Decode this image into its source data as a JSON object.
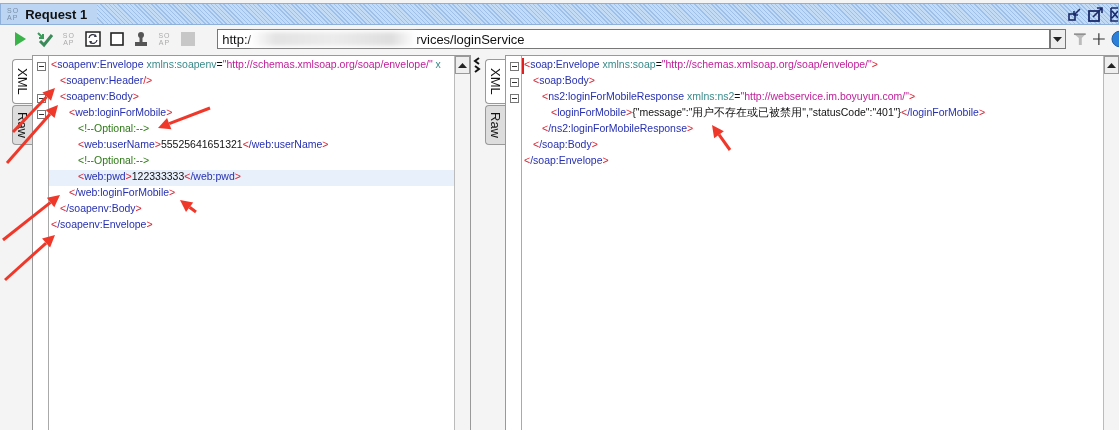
{
  "title_bar": {
    "logo": [
      "SO",
      "AP"
    ],
    "title": "Request 1"
  },
  "toolbar": {
    "buttons": [
      {
        "kind": "run",
        "disabled": false
      },
      {
        "kind": "check",
        "disabled": false
      },
      {
        "kind": "soap",
        "glyph": [
          "SO",
          "AP"
        ],
        "disabled": true
      },
      {
        "kind": "refresh",
        "disabled": false
      },
      {
        "kind": "square",
        "disabled": false
      },
      {
        "kind": "stamp",
        "disabled": false
      },
      {
        "kind": "soap",
        "glyph": [
          "SO",
          "AP"
        ],
        "disabled": true
      },
      {
        "kind": "stop",
        "disabled": true
      }
    ],
    "url_start": "http:/",
    "url_end": "rvices/loginService"
  },
  "request": {
    "tabs": [
      {
        "label": "XML",
        "selected": true
      },
      {
        "label": "Raw",
        "selected": false
      }
    ],
    "lines": [
      {
        "tokens": [
          {
            "kind": "punct",
            "text": "<"
          },
          {
            "kind": "tag",
            "text": "soapenv:Envelope "
          },
          {
            "kind": "attr",
            "text": "xmlns:soapenv"
          },
          {
            "kind": "eq",
            "text": "="
          },
          {
            "kind": "value",
            "text": "\"http://schemas.xmlsoap.org/soap/envelope/\""
          },
          {
            "kind": "attr",
            "text": " x"
          }
        ],
        "foldable": true,
        "selected": false,
        "children": [
          {
            "tokens": [
              {
                "kind": "punct",
                "text": "<"
              },
              {
                "kind": "tag",
                "text": "soapenv:Header"
              },
              {
                "kind": "punct",
                "text": "/>"
              }
            ],
            "foldable": false,
            "selected": false
          },
          {
            "tokens": [
              {
                "kind": "punct",
                "text": "<"
              },
              {
                "kind": "tag",
                "text": "soapenv:Body"
              },
              {
                "kind": "punct",
                "text": ">"
              }
            ],
            "foldable": true,
            "selected": false,
            "children": [
              {
                "tokens": [
                  {
                    "kind": "punct",
                    "text": "<"
                  },
                  {
                    "kind": "tag",
                    "text": "web:loginForMobile"
                  },
                  {
                    "kind": "punct",
                    "text": ">"
                  }
                ],
                "foldable": true,
                "selected": false,
                "children": [
                  {
                    "tokens": [
                      {
                        "kind": "comment",
                        "text": "<!--Optional:-->"
                      }
                    ],
                    "foldable": false,
                    "selected": false
                  },
                  {
                    "tokens": [
                      {
                        "kind": "punct",
                        "text": "<"
                      },
                      {
                        "kind": "tag",
                        "text": "web:userName"
                      },
                      {
                        "kind": "punct",
                        "text": ">"
                      },
                      {
                        "kind": "text",
                        "text": "55525641651321"
                      },
                      {
                        "kind": "punct",
                        "text": "<"
                      },
                      {
                        "kind": "tag",
                        "text": "/web:userName"
                      },
                      {
                        "kind": "punct",
                        "text": ">"
                      }
                    ],
                    "foldable": false,
                    "selected": false
                  },
                  {
                    "tokens": [
                      {
                        "kind": "comment",
                        "text": "<!--Optional:-->"
                      }
                    ],
                    "foldable": false,
                    "selected": false
                  },
                  {
                    "tokens": [
                      {
                        "kind": "punct",
                        "text": "<"
                      },
                      {
                        "kind": "tag",
                        "text": "web:pwd"
                      },
                      {
                        "kind": "punct",
                        "text": ">"
                      },
                      {
                        "kind": "text",
                        "text": "122333333"
                      },
                      {
                        "kind": "punct",
                        "text": "<"
                      },
                      {
                        "kind": "tag",
                        "text": "/web:pwd"
                      },
                      {
                        "kind": "punct",
                        "text": ">"
                      }
                    ],
                    "foldable": false,
                    "selected": true
                  }
                ],
                "close": {
                  "tokens": [
                    {
                      "kind": "punct",
                      "text": "<"
                    },
                    {
                      "kind": "tag",
                      "text": "/web:loginForMobile"
                    },
                    {
                      "kind": "punct",
                      "text": ">"
                    }
                  ],
                  "selected": false
                }
              }
            ],
            "close": {
              "tokens": [
                {
                  "kind": "punct",
                  "text": "<"
                },
                {
                  "kind": "tag",
                  "text": "/soapenv:Body"
                },
                {
                  "kind": "punct",
                  "text": ">"
                }
              ],
              "selected": false
            }
          }
        ],
        "close": {
          "tokens": [
            {
              "kind": "punct",
              "text": "<"
            },
            {
              "kind": "tag",
              "text": "/soapenv:Envelope"
            },
            {
              "kind": "punct",
              "text": ">"
            }
          ],
          "selected": false
        }
      }
    ]
  },
  "response": {
    "tabs": [
      {
        "label": "XML",
        "selected": true
      },
      {
        "label": "Raw",
        "selected": false
      }
    ],
    "lines": [
      {
        "tokens": [
          {
            "kind": "punct",
            "text": "<"
          },
          {
            "kind": "tag",
            "text": "soap:Envelope "
          },
          {
            "kind": "attr",
            "text": "xmlns:soap"
          },
          {
            "kind": "eq",
            "text": "="
          },
          {
            "kind": "value",
            "text": "\"http://schemas.xmlsoap.org/soap/envelope/\""
          },
          {
            "kind": "punct",
            "text": ">"
          }
        ],
        "foldable": true,
        "selected": false,
        "children": [
          {
            "tokens": [
              {
                "kind": "punct",
                "text": "<"
              },
              {
                "kind": "tag",
                "text": "soap:Body"
              },
              {
                "kind": "punct",
                "text": ">"
              }
            ],
            "foldable": true,
            "selected": false,
            "children": [
              {
                "tokens": [
                  {
                    "kind": "punct",
                    "text": "<"
                  },
                  {
                    "kind": "tag",
                    "text": "ns2:loginForMobileResponse "
                  },
                  {
                    "kind": "attr",
                    "text": "xmlns:ns2"
                  },
                  {
                    "kind": "eq",
                    "text": "="
                  },
                  {
                    "kind": "value",
                    "text": "\"http://webservice.im.boyuyun.com/\""
                  },
                  {
                    "kind": "punct",
                    "text": ">"
                  }
                ],
                "foldable": true,
                "selected": false,
                "children": [
                  {
                    "tokens": [
                      {
                        "kind": "punct",
                        "text": "<"
                      },
                      {
                        "kind": "tag",
                        "text": "loginForMobile"
                      },
                      {
                        "kind": "punct",
                        "text": ">"
                      },
                      {
                        "kind": "text",
                        "text": "{\"message\":\"用户不存在或已被禁用\",\"statusCode\":\"401\"}"
                      },
                      {
                        "kind": "punct",
                        "text": "<"
                      },
                      {
                        "kind": "tag",
                        "text": "/loginForMobile"
                      },
                      {
                        "kind": "punct",
                        "text": ">"
                      }
                    ],
                    "foldable": false,
                    "selected": false
                  }
                ],
                "close": {
                  "tokens": [
                    {
                      "kind": "punct",
                      "text": "<"
                    },
                    {
                      "kind": "tag",
                      "text": "/ns2:loginForMobileResponse"
                    },
                    {
                      "kind": "punct",
                      "text": ">"
                    }
                  ],
                  "selected": false
                }
              }
            ],
            "close": {
              "tokens": [
                {
                  "kind": "punct",
                  "text": "<"
                },
                {
                  "kind": "tag",
                  "text": "/soap:Body"
                },
                {
                  "kind": "punct",
                  "text": ">"
                }
              ],
              "selected": false
            }
          }
        ],
        "close": {
          "tokens": [
            {
              "kind": "punct",
              "text": "<"
            },
            {
              "kind": "tag",
              "text": "/soap:Envelope"
            },
            {
              "kind": "punct",
              "text": ">"
            }
          ],
          "selected": false
        }
      }
    ]
  }
}
